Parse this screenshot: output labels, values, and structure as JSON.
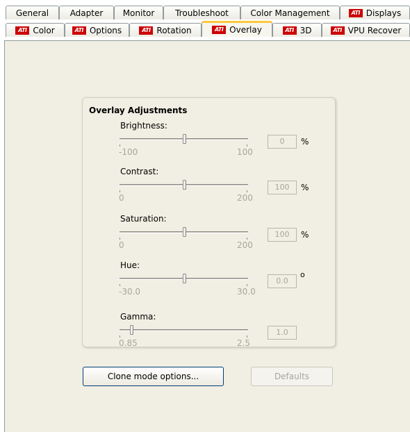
{
  "tabs_row1": [
    {
      "label": "General",
      "ati": false
    },
    {
      "label": "Adapter",
      "ati": false
    },
    {
      "label": "Monitor",
      "ati": false
    },
    {
      "label": "Troubleshoot",
      "ati": false
    },
    {
      "label": "Color Management",
      "ati": false
    },
    {
      "label": "Displays",
      "ati": true
    }
  ],
  "tabs_row2": [
    {
      "label": "Color",
      "ati": true
    },
    {
      "label": "Options",
      "ati": true
    },
    {
      "label": "Rotation",
      "ati": true
    },
    {
      "label": "Overlay",
      "ati": true,
      "active": true
    },
    {
      "label": "3D",
      "ati": true
    },
    {
      "label": "VPU Recover",
      "ati": true
    }
  ],
  "ati_logo_text": "ATI",
  "group": {
    "title": "Overlay Adjustments",
    "sliders": [
      {
        "name": "brightness",
        "label": "Brightness:",
        "min_label": "-100",
        "max_label": "100",
        "min": -100,
        "max": 100,
        "value": 0,
        "display": "0",
        "unit": "%"
      },
      {
        "name": "contrast",
        "label": "Contrast:",
        "min_label": "0",
        "max_label": "200",
        "min": 0,
        "max": 200,
        "value": 100,
        "display": "100",
        "unit": "%"
      },
      {
        "name": "saturation",
        "label": "Saturation:",
        "min_label": "0",
        "max_label": "200",
        "min": 0,
        "max": 200,
        "value": 100,
        "display": "100",
        "unit": "%"
      },
      {
        "name": "hue",
        "label": "Hue:",
        "min_label": "-30.0",
        "max_label": "30.0",
        "min": -30,
        "max": 30,
        "value": 0,
        "display": "0.0",
        "unit": "o"
      },
      {
        "name": "gamma",
        "label": "Gamma:",
        "min_label": "0.85",
        "max_label": "2.5",
        "min": 0.85,
        "max": 2.5,
        "value": 1.0,
        "display": "1.0",
        "unit": ""
      }
    ]
  },
  "buttons": {
    "clone": "Clone mode options...",
    "defaults": "Defaults"
  }
}
